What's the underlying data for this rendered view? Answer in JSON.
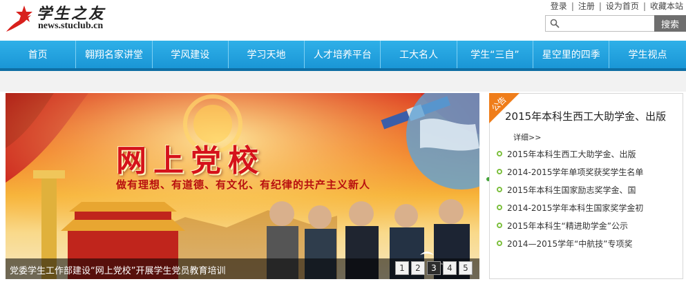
{
  "header": {
    "logo_cn": "学生之友",
    "logo_url": "news.stuclub.cn",
    "links": [
      "登录",
      "注册",
      "设为首页",
      "收藏本站"
    ],
    "link_separator": "|",
    "search": {
      "value": "",
      "placeholder": "",
      "button_label": "搜索"
    }
  },
  "nav": {
    "items": [
      "首页",
      "翱翔名家讲堂",
      "学风建设",
      "学习天地",
      "人才培养平台",
      "工大名人",
      "学生“三自”",
      "星空里的四季",
      "学生视点"
    ],
    "color": "#1ea0dc"
  },
  "banner": {
    "title": "网上党校",
    "slogan": "做有理想、有道德、有文化、有纪律的共产主义新人",
    "caption": "党委学生工作部建设“网上党校”开展学生党员教育培训",
    "pages": [
      "1",
      "2",
      "3",
      "4",
      "5"
    ],
    "active_page": "3"
  },
  "notice": {
    "tag": "公告",
    "headline": "2015年本科生西工大助学金、出版",
    "more": "详细>>",
    "items": [
      "2015年本科生西工大助学金、出版",
      "2014-2015学年单项奖获奖学生名单",
      "2015年本科生国家励志奖学金、国",
      "2014-2015学年本科生国家奖学金初",
      "2015年本科生“精进助学金”公示",
      "2014—2015学年“中航技”专项奖"
    ],
    "accent_color": "#ef7d1a",
    "bullet_color": "#7cbf3d"
  }
}
